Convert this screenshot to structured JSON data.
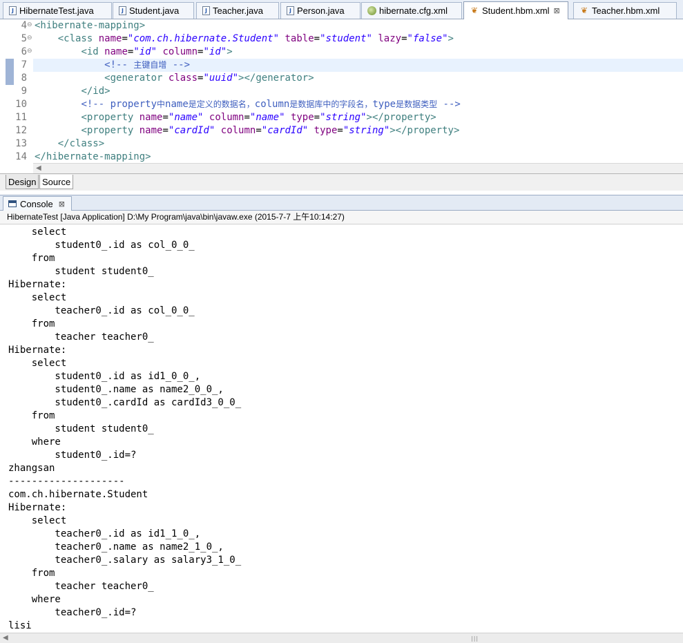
{
  "editor_tabs": [
    {
      "label": "HibernateTest.java",
      "icon": "java-file-icon"
    },
    {
      "label": "Student.java",
      "icon": "java-file-icon"
    },
    {
      "label": "Teacher.java",
      "icon": "java-file-icon"
    },
    {
      "label": "Person.java",
      "icon": "java-file-icon"
    },
    {
      "label": "hibernate.cfg.xml",
      "icon": "xml-file-icon"
    },
    {
      "label": "Student.hbm.xml",
      "icon": "hbm-file-icon",
      "active": true,
      "close": "⊠"
    },
    {
      "label": "Teacher.hbm.xml",
      "icon": "hbm-file-icon"
    }
  ],
  "code_lines": [
    {
      "n": "4",
      "fold": "⊖",
      "parts": [
        [
          "tg",
          "<hibernate-mapping>"
        ]
      ]
    },
    {
      "n": "5",
      "fold": "⊖",
      "parts": [
        [
          "",
          "    "
        ],
        [
          "tg",
          "<class "
        ],
        [
          "at",
          "name"
        ],
        [
          "",
          "="
        ],
        [
          "av",
          "\"com.ch.hibernate.Student\""
        ],
        [
          "",
          " "
        ],
        [
          "at",
          "table"
        ],
        [
          "",
          "="
        ],
        [
          "av",
          "\"student\""
        ],
        [
          "",
          " "
        ],
        [
          "at",
          "lazy"
        ],
        [
          "",
          "="
        ],
        [
          "av",
          "\"false\""
        ],
        [
          "tg",
          ">"
        ]
      ]
    },
    {
      "n": "6",
      "fold": "⊖",
      "parts": [
        [
          "",
          "        "
        ],
        [
          "tg",
          "<id "
        ],
        [
          "at",
          "name"
        ],
        [
          "",
          "="
        ],
        [
          "av",
          "\"id\""
        ],
        [
          "",
          " "
        ],
        [
          "at",
          "column"
        ],
        [
          "",
          "="
        ],
        [
          "av",
          "\"id\""
        ],
        [
          "tg",
          ">"
        ]
      ]
    },
    {
      "n": "7",
      "fold": "",
      "parts": [
        [
          "",
          "            "
        ],
        [
          "cm",
          "<!-- "
        ],
        [
          "cmk",
          "主键自增"
        ],
        [
          "cm",
          " -->"
        ]
      ]
    },
    {
      "n": "8",
      "fold": "",
      "parts": [
        [
          "",
          "            "
        ],
        [
          "tg",
          "<generator "
        ],
        [
          "at",
          "class"
        ],
        [
          "",
          "="
        ],
        [
          "av",
          "\"uuid\""
        ],
        [
          "tg",
          "></generator>"
        ]
      ]
    },
    {
      "n": "9",
      "fold": "",
      "parts": [
        [
          "",
          "        "
        ],
        [
          "tg",
          "</id>"
        ]
      ]
    },
    {
      "n": "10",
      "fold": "",
      "parts": [
        [
          "",
          "        "
        ],
        [
          "cm",
          "<!-- property"
        ],
        [
          "cmk",
          "中"
        ],
        [
          "cm",
          "name"
        ],
        [
          "cmk",
          "是定义的数据名，"
        ],
        [
          "cm",
          "column"
        ],
        [
          "cmk",
          "是数据库中的字段名，"
        ],
        [
          "cm",
          "type"
        ],
        [
          "cmk",
          "是数据类型"
        ],
        [
          "cm",
          " -->"
        ]
      ]
    },
    {
      "n": "11",
      "fold": "",
      "parts": [
        [
          "",
          "        "
        ],
        [
          "tg",
          "<property "
        ],
        [
          "at",
          "name"
        ],
        [
          "",
          "="
        ],
        [
          "av",
          "\"name\""
        ],
        [
          "",
          " "
        ],
        [
          "at",
          "column"
        ],
        [
          "",
          "="
        ],
        [
          "av",
          "\"name\""
        ],
        [
          "",
          " "
        ],
        [
          "at",
          "type"
        ],
        [
          "",
          "="
        ],
        [
          "av",
          "\"string\""
        ],
        [
          "tg",
          "></property>"
        ]
      ]
    },
    {
      "n": "12",
      "fold": "",
      "parts": [
        [
          "",
          "        "
        ],
        [
          "tg",
          "<property "
        ],
        [
          "at",
          "name"
        ],
        [
          "",
          "="
        ],
        [
          "av",
          "\"cardId\""
        ],
        [
          "",
          " "
        ],
        [
          "at",
          "column"
        ],
        [
          "",
          "="
        ],
        [
          "av",
          "\"cardId\""
        ],
        [
          "",
          " "
        ],
        [
          "at",
          "type"
        ],
        [
          "",
          "="
        ],
        [
          "av",
          "\"string\""
        ],
        [
          "tg",
          "></property>"
        ]
      ]
    },
    {
      "n": "13",
      "fold": "",
      "parts": [
        [
          "",
          "    "
        ],
        [
          "tg",
          "</class>"
        ]
      ]
    },
    {
      "n": "14",
      "fold": "",
      "parts": [
        [
          "tg",
          "</hibernate-mapping>"
        ]
      ]
    }
  ],
  "editor_bottom_tabs": {
    "design": "Design",
    "source": "Source"
  },
  "console": {
    "tab_label": "Console",
    "close_glyph": "⊠",
    "process_line": "HibernateTest [Java Application] D:\\My Program\\java\\bin\\javaw.exe (2015-7-7 上午10:14:27)",
    "lines": [
      "    select",
      "        student0_.id as col_0_0_",
      "    from",
      "        student student0_",
      "Hibernate:",
      "    select",
      "        teacher0_.id as col_0_0_",
      "    from",
      "        teacher teacher0_",
      "Hibernate:",
      "    select",
      "        student0_.id as id1_0_0_,",
      "        student0_.name as name2_0_0_,",
      "        student0_.cardId as cardId3_0_0_",
      "    from",
      "        student student0_",
      "    where",
      "        student0_.id=?",
      "zhangsan",
      "--------------------",
      "com.ch.hibernate.Student",
      "Hibernate:",
      "    select",
      "        teacher0_.id as id1_1_0_,",
      "        teacher0_.name as name2_1_0_,",
      "        teacher0_.salary as salary3_1_0_",
      "    from",
      "        teacher teacher0_",
      "    where",
      "        teacher0_.id=?",
      "lisi"
    ]
  }
}
